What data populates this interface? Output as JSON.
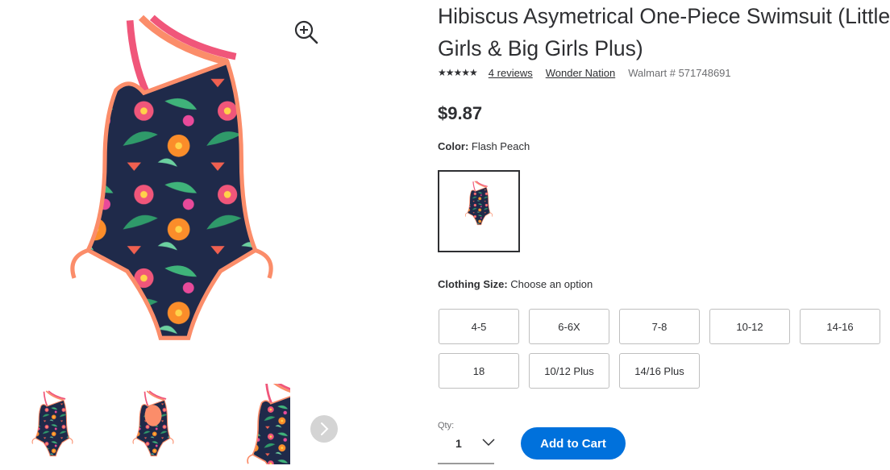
{
  "product": {
    "title_line1": "Hibiscus Asymetrical One-Piece Swimsuit (Little Girls & Big Girls Plus)",
    "title_display_line1": "Hibiscus Asymetrical One-Piece Swimsuit (Little G",
    "title_display_line2": "Girls & Big Girls Plus)",
    "rating_stars": "★★★★★",
    "rating_value": 4.5,
    "reviews_link": "4 reviews",
    "brand_link": "Wonder Nation",
    "sku": "Walmart # 571748691",
    "price": "$9.87"
  },
  "color": {
    "label": "Color:",
    "value": "Flash Peach"
  },
  "size": {
    "label": "Clothing Size:",
    "value": "Choose an option",
    "options": [
      "4-5",
      "6-6X",
      "7-8",
      "10-12",
      "14-16",
      "18",
      "10/12 Plus",
      "14/16 Plus"
    ]
  },
  "quantity": {
    "label": "Qty:",
    "value": "1"
  },
  "cart": {
    "label": "Add to Cart"
  },
  "colors": {
    "accent": "#0071dc",
    "swimsuit_navy": "#1f2a4a",
    "strap_pink": "#f0567a",
    "strap_peach": "#fb8d6a"
  },
  "icons": {
    "zoom": "zoom-in-icon",
    "next": "chevron-right-icon",
    "qty": "chevron-down-icon"
  }
}
